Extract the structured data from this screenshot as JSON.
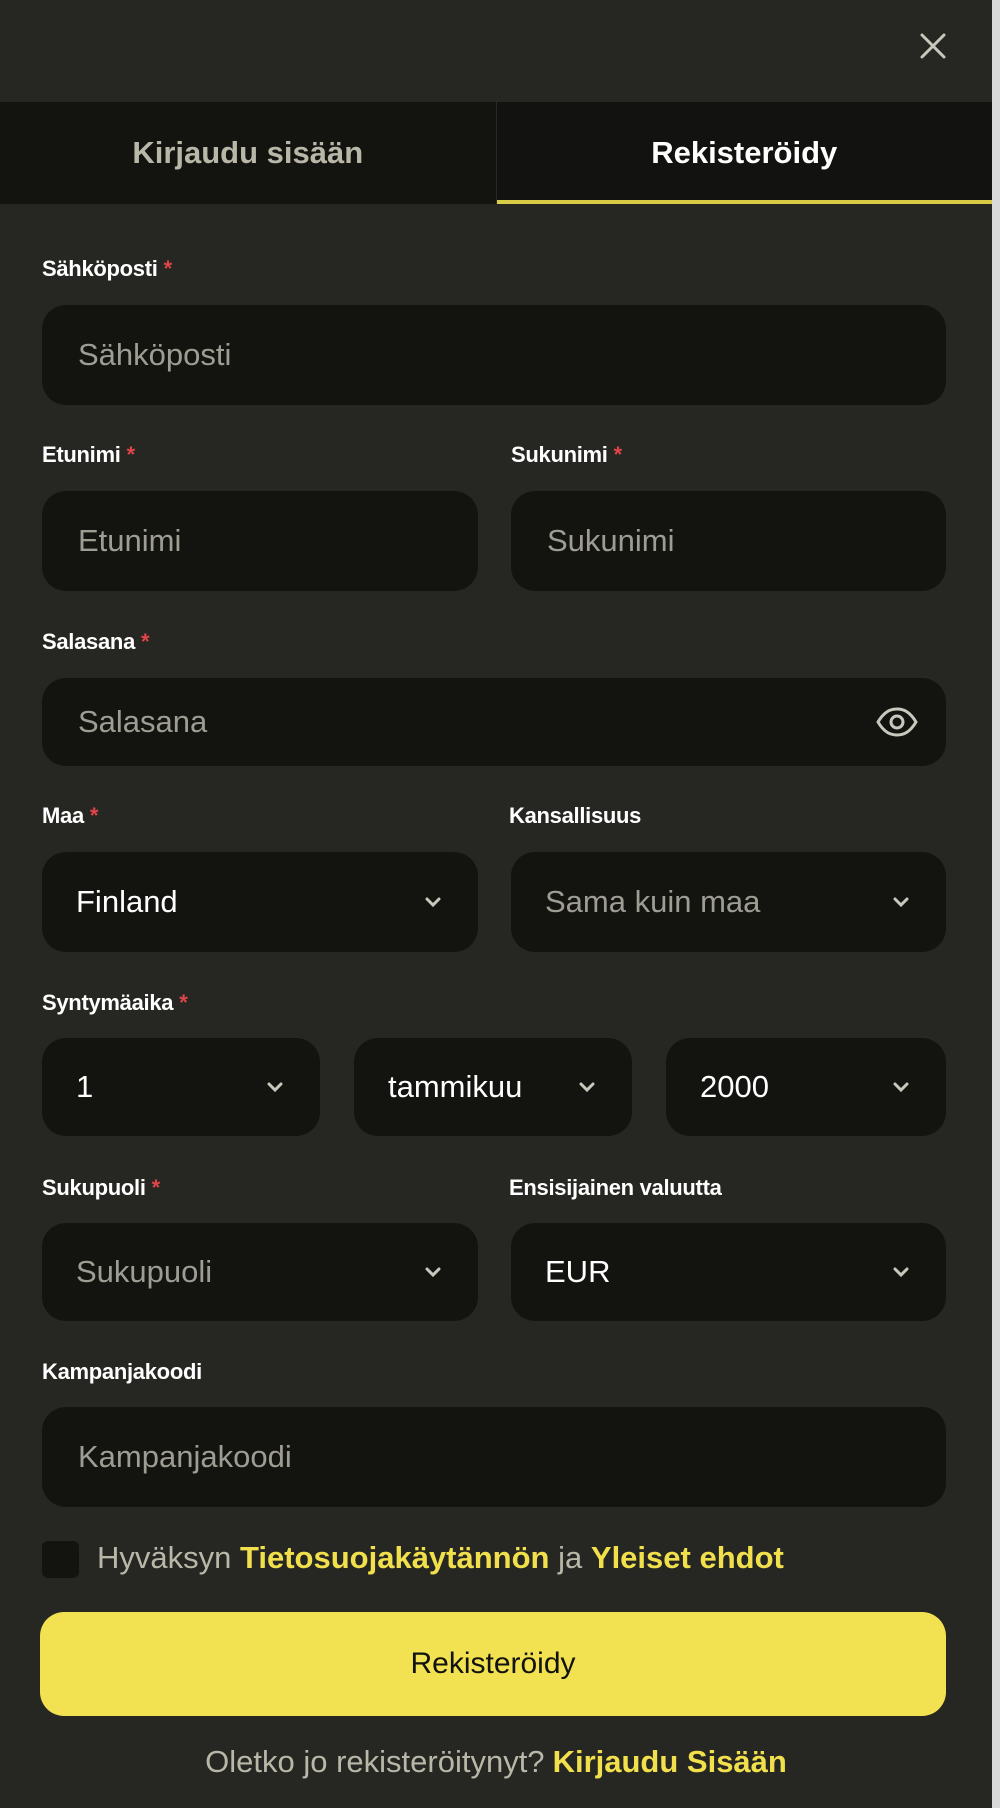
{
  "tabs": [
    {
      "label": "Kirjaudu sisään",
      "active": false
    },
    {
      "label": "Rekisteröidy",
      "active": true
    }
  ],
  "required_mark": "*",
  "fields": {
    "email": {
      "label": "Sähköposti",
      "placeholder": "Sähköposti",
      "value": ""
    },
    "first_name": {
      "label": "Etunimi",
      "placeholder": "Etunimi",
      "value": ""
    },
    "last_name": {
      "label": "Sukunimi",
      "placeholder": "Sukunimi",
      "value": ""
    },
    "password": {
      "label": "Salasana",
      "placeholder": "Salasana",
      "value": ""
    },
    "country": {
      "label": "Maa",
      "value": "Finland"
    },
    "nationality": {
      "label": "Kansallisuus",
      "placeholder": "Sama kuin maa"
    },
    "birthdate": {
      "label": "Syntymäaika",
      "day": "1",
      "month": "tammikuu",
      "year": "2000"
    },
    "gender": {
      "label": "Sukupuoli",
      "placeholder": "Sukupuoli"
    },
    "currency": {
      "label": "Ensisijainen valuutta",
      "value": "EUR"
    },
    "promo": {
      "label": "Kampanjakoodi",
      "placeholder": "Kampanjakoodi",
      "value": ""
    }
  },
  "consent": {
    "prefix": "Hyväksyn",
    "privacy_link": "Tietosuojakäytännön",
    "connector": "ja",
    "terms_link": "Yleiset ehdot",
    "checked": false
  },
  "submit_label": "Rekisteröidy",
  "footer": {
    "question": "Oletko jo rekisteröitynyt?",
    "login_link": "Kirjaudu Sisään"
  },
  "icons": {
    "close": "close-icon",
    "eye": "eye-icon",
    "chevron": "chevron-down-icon"
  },
  "colors": {
    "background": "#262622",
    "input_background": "#131310",
    "accent": "#f2e150",
    "required": "#e0454a",
    "muted_text": "#b9b8a8"
  }
}
